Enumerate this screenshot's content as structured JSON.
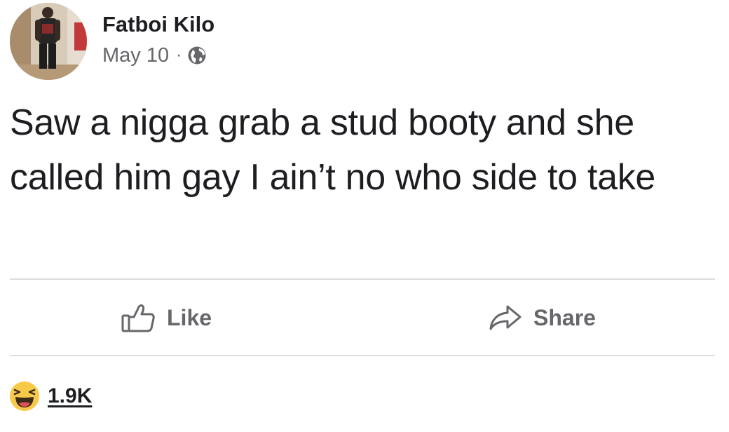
{
  "post": {
    "author": "Fatboi Kilo",
    "date": "May 10",
    "separator": "·",
    "privacy_icon": "globe-icon",
    "text": "Saw a nigga grab a stud booty and she called him gay I ain’t no who side to take"
  },
  "actions": {
    "like_label": "Like",
    "like_icon": "thumbs-up-icon",
    "share_label": "Share",
    "share_icon": "share-arrow-icon"
  },
  "reactions": {
    "icon": "haha-emoji-icon",
    "count": "1.9K"
  },
  "colors": {
    "text": "#1c1e21",
    "secondary": "#65676b",
    "divider": "#dcdde1",
    "haha_yellow": "#f7c948"
  }
}
